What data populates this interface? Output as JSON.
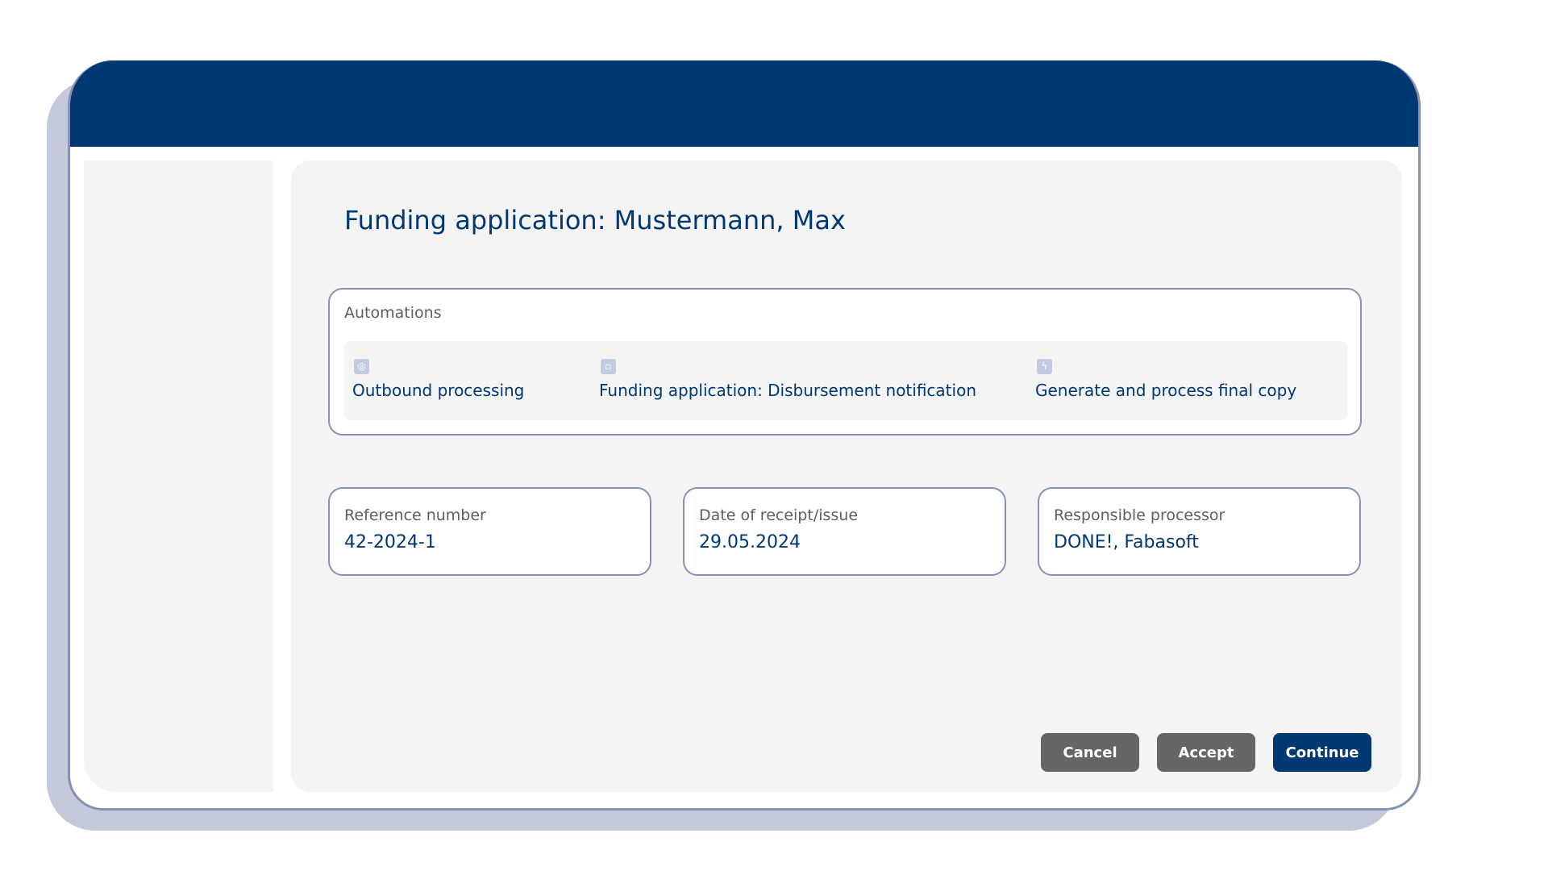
{
  "page": {
    "title": "Funding application: Mustermann, Max"
  },
  "automations": {
    "heading": "Automations",
    "items": [
      {
        "label": "Outbound processing",
        "icon": "gear-icon",
        "glyph": "◎"
      },
      {
        "label": "Funding application: Disbursement notification",
        "icon": "document-icon",
        "glyph": "▫"
      },
      {
        "label": "Generate and process final copy",
        "icon": "bolt-icon",
        "glyph": "ϟ"
      }
    ]
  },
  "fields": [
    {
      "label": "Reference number",
      "value": "42-2024-1"
    },
    {
      "label": "Date of receipt/issue",
      "value": "29.05.2024"
    },
    {
      "label": "Responsible processor",
      "value": "DONE!, Fabasoft"
    }
  ],
  "actions": {
    "cancel": "Cancel",
    "accept": "Accept",
    "continue": "Continue"
  },
  "colors": {
    "brand": "#003874",
    "border": "#8891b3",
    "grey_button": "#656565",
    "shadow": "#c4c9dc"
  }
}
